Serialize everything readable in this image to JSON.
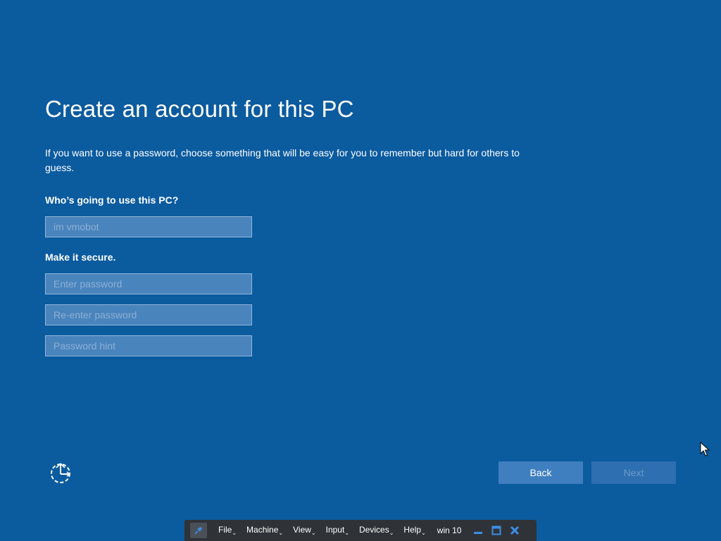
{
  "oobe": {
    "title": "Create an account for this PC",
    "description": "If you want to use a password, choose something that will be easy for you to remember but hard for others to guess.",
    "user_label": "Who’s going to use this PC?",
    "user_field": {
      "value": "",
      "placeholder": "im vmobot"
    },
    "secure_label": "Make it secure.",
    "password_field": {
      "value": "",
      "placeholder": "Enter password"
    },
    "reenter_field": {
      "value": "",
      "placeholder": "Re-enter password"
    },
    "hint_field": {
      "value": "",
      "placeholder": "Password hint"
    },
    "back_label": "Back",
    "next_label": "Next",
    "ease_icon": "ease-of-access-icon"
  },
  "vm_toolbar": {
    "pin_icon": "pin-icon",
    "menus": [
      "File",
      "Machine",
      "View",
      "Input",
      "Devices",
      "Help"
    ],
    "vm_name": "win 10",
    "minimize_icon": "minimize-icon",
    "restore_icon": "restore-icon",
    "close_icon": "close-icon"
  },
  "colors": {
    "background": "#0b5b9f",
    "field_bg": "#4a84bd",
    "button_bg": "#3f7fbf",
    "toolbar_bg": "#2f3338",
    "accent_blue": "#3c8ee6"
  }
}
